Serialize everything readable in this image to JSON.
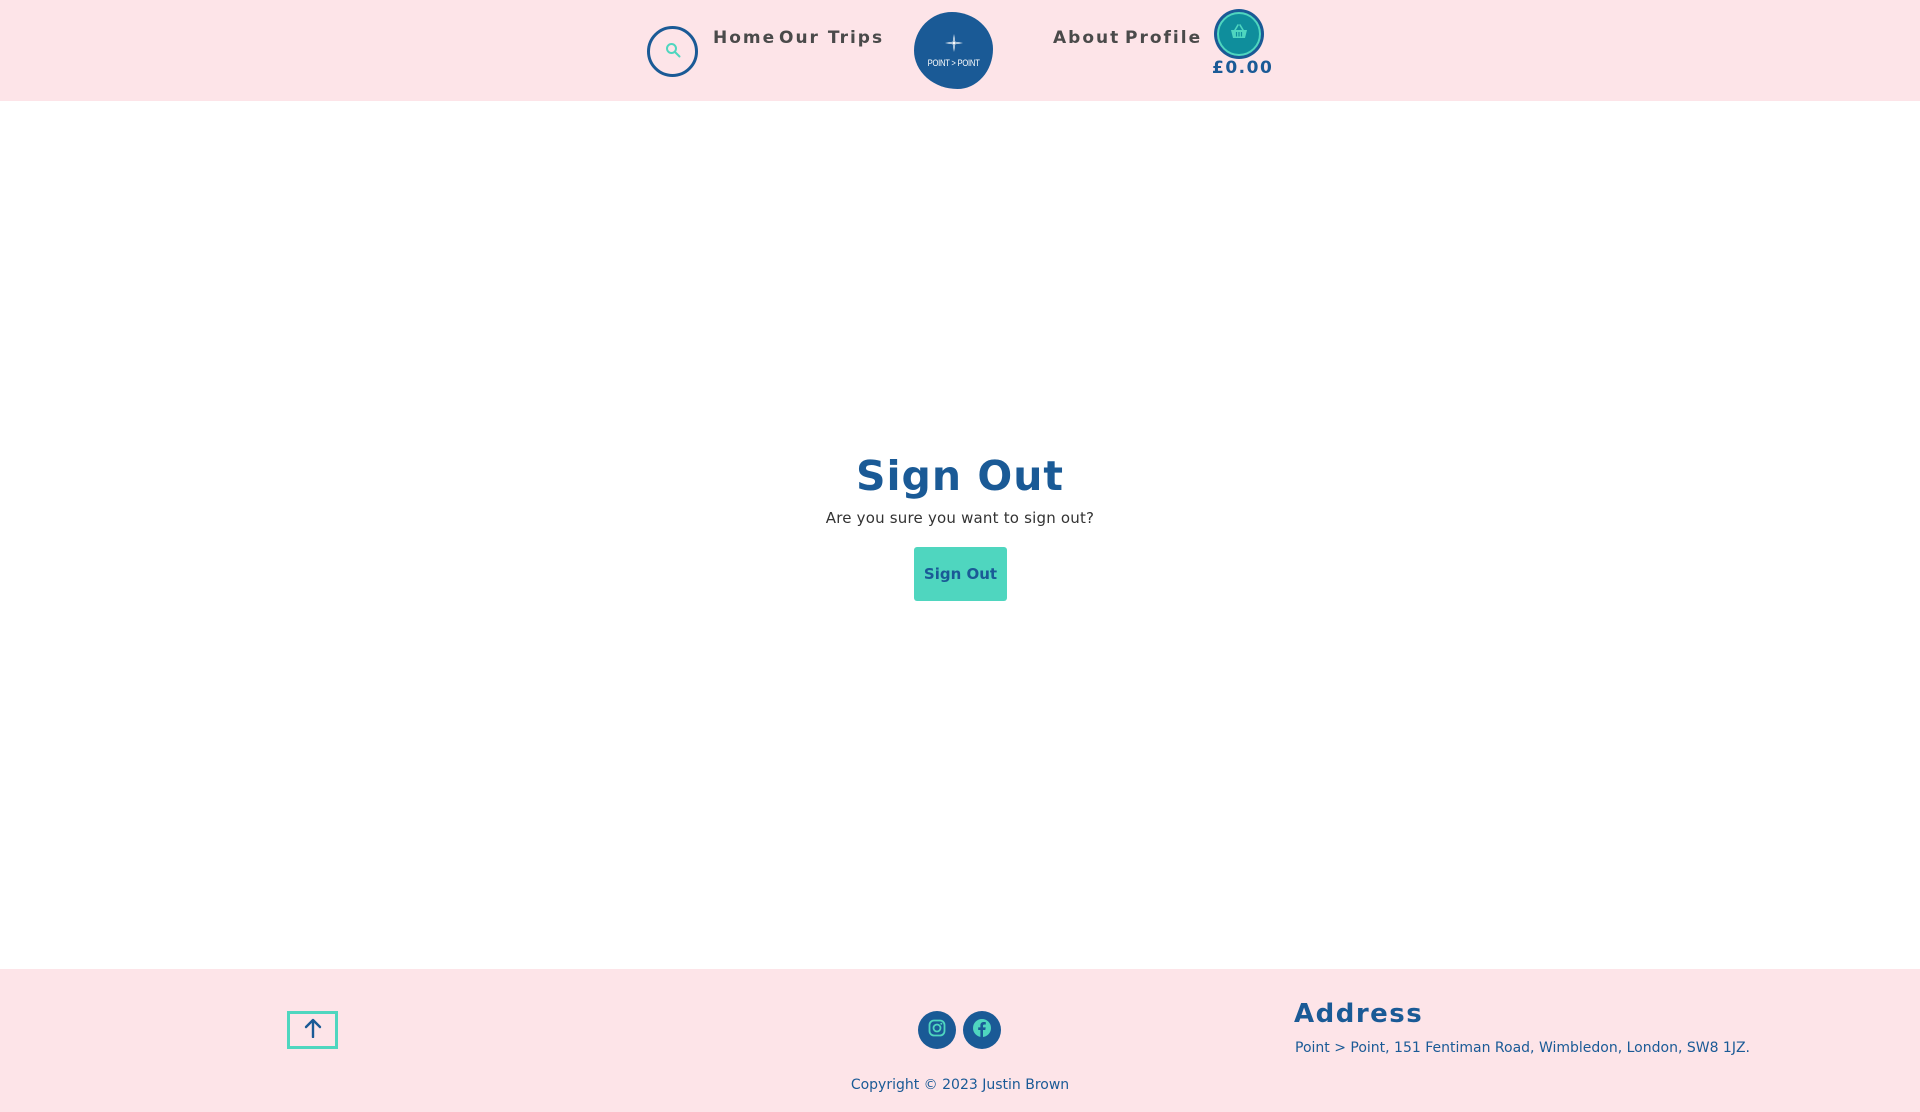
{
  "header": {
    "nav_left": [
      {
        "label": "Home"
      },
      {
        "label": "Our Trips"
      }
    ],
    "logo_text": "POINT > POINT",
    "nav_right": [
      {
        "label": "About"
      },
      {
        "label": "Profile"
      }
    ],
    "cart_total": "£0.00",
    "search_icon": "search-icon",
    "cart_icon": "basket-icon"
  },
  "main": {
    "title": "Sign Out",
    "subtitle": "Are you sure you want to sign out?",
    "button_label": "Sign Out"
  },
  "footer": {
    "address_title": "Address",
    "address_text": "Point > Point, 151 Fentiman Road, Wimbledon, London, SW8 1JZ.",
    "copyright": "Copyright © 2023 Justin Brown",
    "social_icons": [
      "instagram-icon",
      "facebook-icon"
    ],
    "to_top_icon": "arrow-up-icon"
  },
  "colors": {
    "header_bg": "#fde4e8",
    "brand_blue": "#1a5a96",
    "accent_teal": "#4fd6bf",
    "nav_text": "#4a4a4a"
  }
}
